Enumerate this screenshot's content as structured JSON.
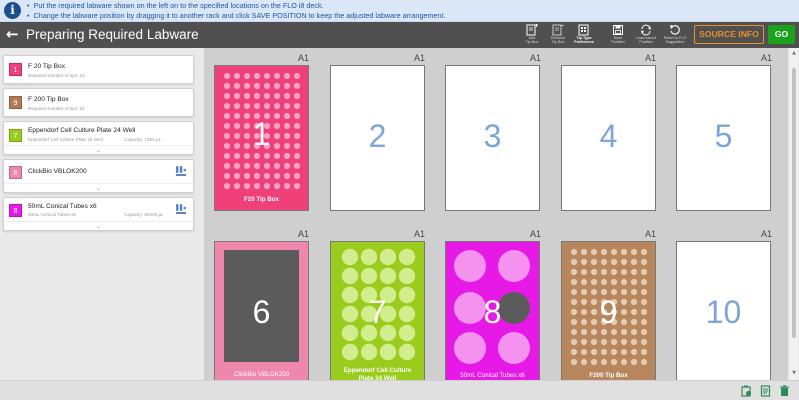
{
  "banner": {
    "lines": [
      "Put the required labware shown on the left on to the specified locations on the FLO i8 deck.",
      "Change the labware position by dragging it to another rack and click SAVE POSITION to keep the adjusted labware arrangement."
    ]
  },
  "header": {
    "title": "Preparing Required Labware",
    "toolbar": [
      {
        "icon": "add-tip-box-icon",
        "label_1": "Add",
        "label_2": "Tip Box"
      },
      {
        "icon": "remove-tip-box-icon",
        "label_1": "Remove",
        "label_2": "Tip Box"
      },
      {
        "icon": "tip-type-preference-icon",
        "label_1": "Tip Type",
        "label_2": "Preference"
      },
      {
        "icon": "save-position-icon",
        "label_1": "Save",
        "label_2": "Position"
      },
      {
        "icon": "load-saved-position-icon",
        "label_1": "Load saved",
        "label_2": "Position"
      },
      {
        "icon": "reset-suggestion-icon",
        "label_1": "Reset to FLO",
        "label_2": "Suggestion"
      }
    ],
    "source_info": "SOURCE INFO",
    "go": "GO"
  },
  "labware_list": [
    {
      "badge": "1",
      "color": "#f0407a",
      "name": "F 20 Tip Box",
      "sub": "Required number of tips: 24"
    },
    {
      "badge": "9",
      "color": "#b37a52",
      "name": "F 200 Tip Box",
      "sub": "Required number of tips: 24"
    },
    {
      "badge": "7",
      "color": "#99cc1c",
      "name": "Eppendorf Cell Culture Plate 24 Well",
      "sub": "Eppendorf Cell Culture Plate 24 Well",
      "capacity": "Capacity: 1000 µL",
      "expand": "⌄"
    },
    {
      "badge": "6",
      "color": "#ef86ab",
      "name": "ClickBio VBLOK200",
      "expand": "⌄"
    },
    {
      "badge": "8",
      "color": "#e619e6",
      "name": "50mL Conical Tubes x6",
      "sub": "50mL Conical Tubes x6",
      "capacity": "Capacity: 50000 µL",
      "expand": "⌄"
    }
  ],
  "deck": {
    "slot_label": "A1",
    "slots": [
      {
        "number": "1",
        "labware": "F20 Tip Box",
        "color": "#f0407a"
      },
      {
        "number": "2"
      },
      {
        "number": "3"
      },
      {
        "number": "4"
      },
      {
        "number": "5"
      },
      {
        "number": "6",
        "labware": "ClickBio VBLOK200",
        "color": "#ef86ab"
      },
      {
        "number": "7",
        "labware": "Eppendorf Cell Culture Plate 24 Well",
        "labware_line1": "Eppendorf Cell Culture",
        "labware_line2": "Plate 24 Well",
        "color": "#99cc1c"
      },
      {
        "number": "8",
        "labware": "50mL Conical Tubes x6",
        "color": "#e619e6"
      },
      {
        "number": "9",
        "labware": "F200 Tip Box",
        "color": "#b8865c"
      },
      {
        "number": "10"
      }
    ]
  }
}
